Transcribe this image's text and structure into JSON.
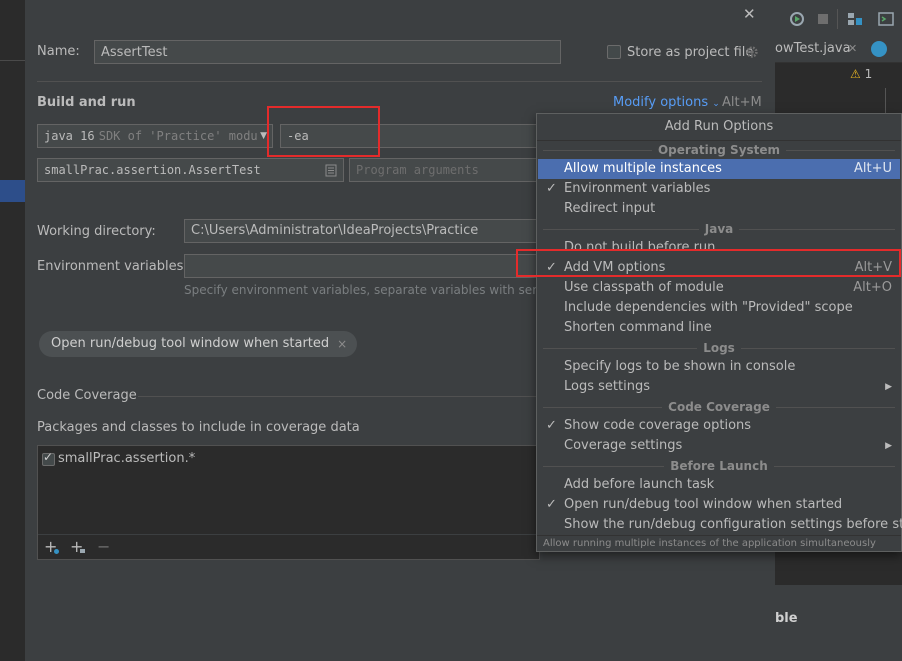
{
  "ide_backdrop": {
    "editor_tab": "owTest.java",
    "warning_count": "1",
    "bottom_text": "ble"
  },
  "dialog": {
    "close_glyph": "✕",
    "name_label": "Name:",
    "name_value": "AssertTest",
    "store_label": "Store as project file",
    "build_section": "Build and run",
    "modify_options_link": "Modify options",
    "modify_options_shortcut": "Alt+M",
    "jdk_select": "java 16",
    "jdk_select_hint": "SDK of 'Practice' modu",
    "vm_options_value": "-ea",
    "main_class_value": "smallPrac.assertion.AssertTest",
    "program_args_placeholder": "Program arguments",
    "working_dir_label": "Working directory:",
    "working_dir_value": "C:\\Users\\Administrator\\IdeaProjects\\Practice",
    "env_label": "Environment variables:",
    "env_value": "",
    "env_hint": "Specify environment variables, separate variables with semic",
    "chip_label": "Open run/debug tool window when started",
    "chip_close": "×",
    "coverage_section": "Code Coverage",
    "packages_label": "Packages and classes to include in coverage data",
    "coverage_entry": "smallPrac.assertion.*",
    "toolbar_add": "+",
    "toolbar_add_pkg": "+",
    "toolbar_remove": "−"
  },
  "popup": {
    "title": "Add Run Options",
    "status": "Allow running multiple instances of the application simultaneously",
    "groups": [
      {
        "label": "Operating System"
      },
      {
        "label": "Java"
      },
      {
        "label": "Logs"
      },
      {
        "label": "Code Coverage"
      },
      {
        "label": "Before Launch"
      }
    ],
    "items": [
      {
        "label": "Allow multiple instances",
        "checked": false,
        "shortcut": "Alt+U",
        "selected": true
      },
      {
        "label": "Environment variables",
        "checked": true,
        "shortcut": ""
      },
      {
        "label": "Redirect input",
        "checked": false,
        "shortcut": ""
      },
      {
        "label": "Do not build before run",
        "checked": false,
        "shortcut": ""
      },
      {
        "label": "Add VM options",
        "checked": true,
        "shortcut": "Alt+V"
      },
      {
        "label": "Use classpath of module",
        "checked": false,
        "shortcut": "Alt+O"
      },
      {
        "label": "Include dependencies with \"Provided\" scope",
        "checked": false,
        "shortcut": ""
      },
      {
        "label": "Shorten command line",
        "checked": false,
        "shortcut": ""
      },
      {
        "label": "Specify logs to be shown in console",
        "checked": false,
        "shortcut": ""
      },
      {
        "label": "Logs settings",
        "checked": false,
        "submenu": true
      },
      {
        "label": "Show code coverage options",
        "checked": true,
        "shortcut": ""
      },
      {
        "label": "Coverage settings",
        "checked": false,
        "submenu": true
      },
      {
        "label": "Add before launch task",
        "checked": false,
        "shortcut": ""
      },
      {
        "label": "Open run/debug tool window when started",
        "checked": true,
        "shortcut": ""
      },
      {
        "label": "Show the run/debug configuration settings before start",
        "checked": false,
        "shortcut": ""
      }
    ],
    "check_glyph": "✓",
    "submenu_glyph": "▶"
  },
  "colors": {
    "background": "#3c3f41",
    "selection": "#4b6eaf",
    "link": "#589df6",
    "highlight_box": "#e42b2b"
  }
}
